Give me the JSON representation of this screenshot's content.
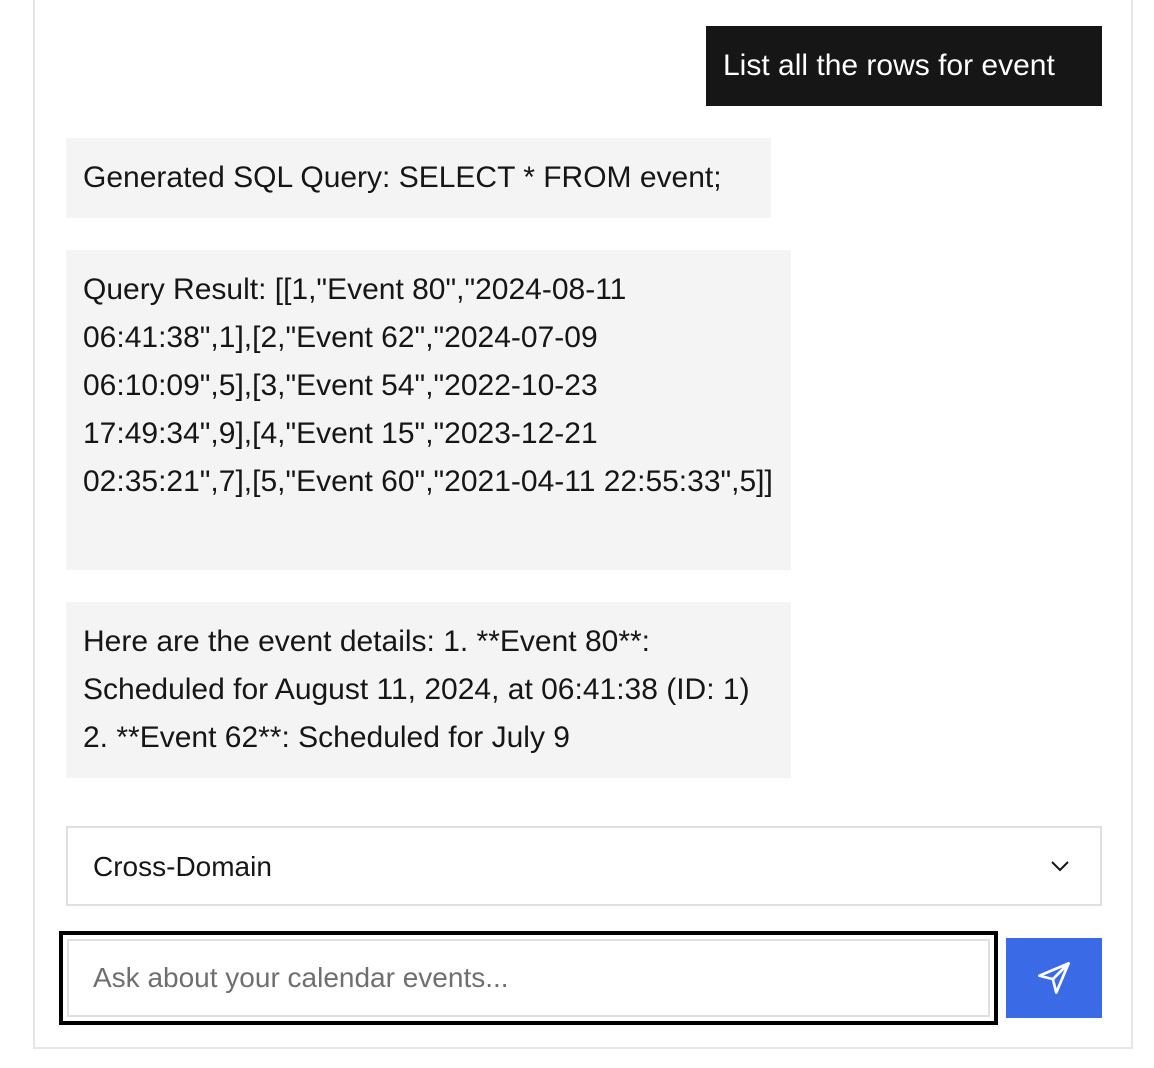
{
  "chat": {
    "user_message": "List all the rows for event",
    "bot_messages": [
      "Generated SQL Query: SELECT * FROM event;",
      "Query Result: [[1,\"Event 80\",\"2024-08-11 06:41:38\",1],[2,\"Event 62\",\"2024-07-09 06:10:09\",5],[3,\"Event 54\",\"2022-10-23 17:49:34\",9],[4,\"Event 15\",\"2023-12-21 02:35:21\",7],[5,\"Event 60\",\"2021-04-11 22:55:33\",5]]",
      "Here are the event details: 1. **Event 80**: Scheduled for August 11, 2024, at 06:41:38 (ID: 1) 2. **Event 62**: Scheduled for July 9"
    ]
  },
  "domain_select": {
    "selected": "Cross-Domain",
    "icon": "chevron-down-icon"
  },
  "query_input": {
    "value": "",
    "placeholder": "Ask about your calendar events..."
  },
  "send_button": {
    "icon": "send-icon"
  },
  "colors": {
    "user_bubble": "#161616",
    "bot_bubble": "#f4f4f4",
    "accent": "#3b6ae6"
  }
}
